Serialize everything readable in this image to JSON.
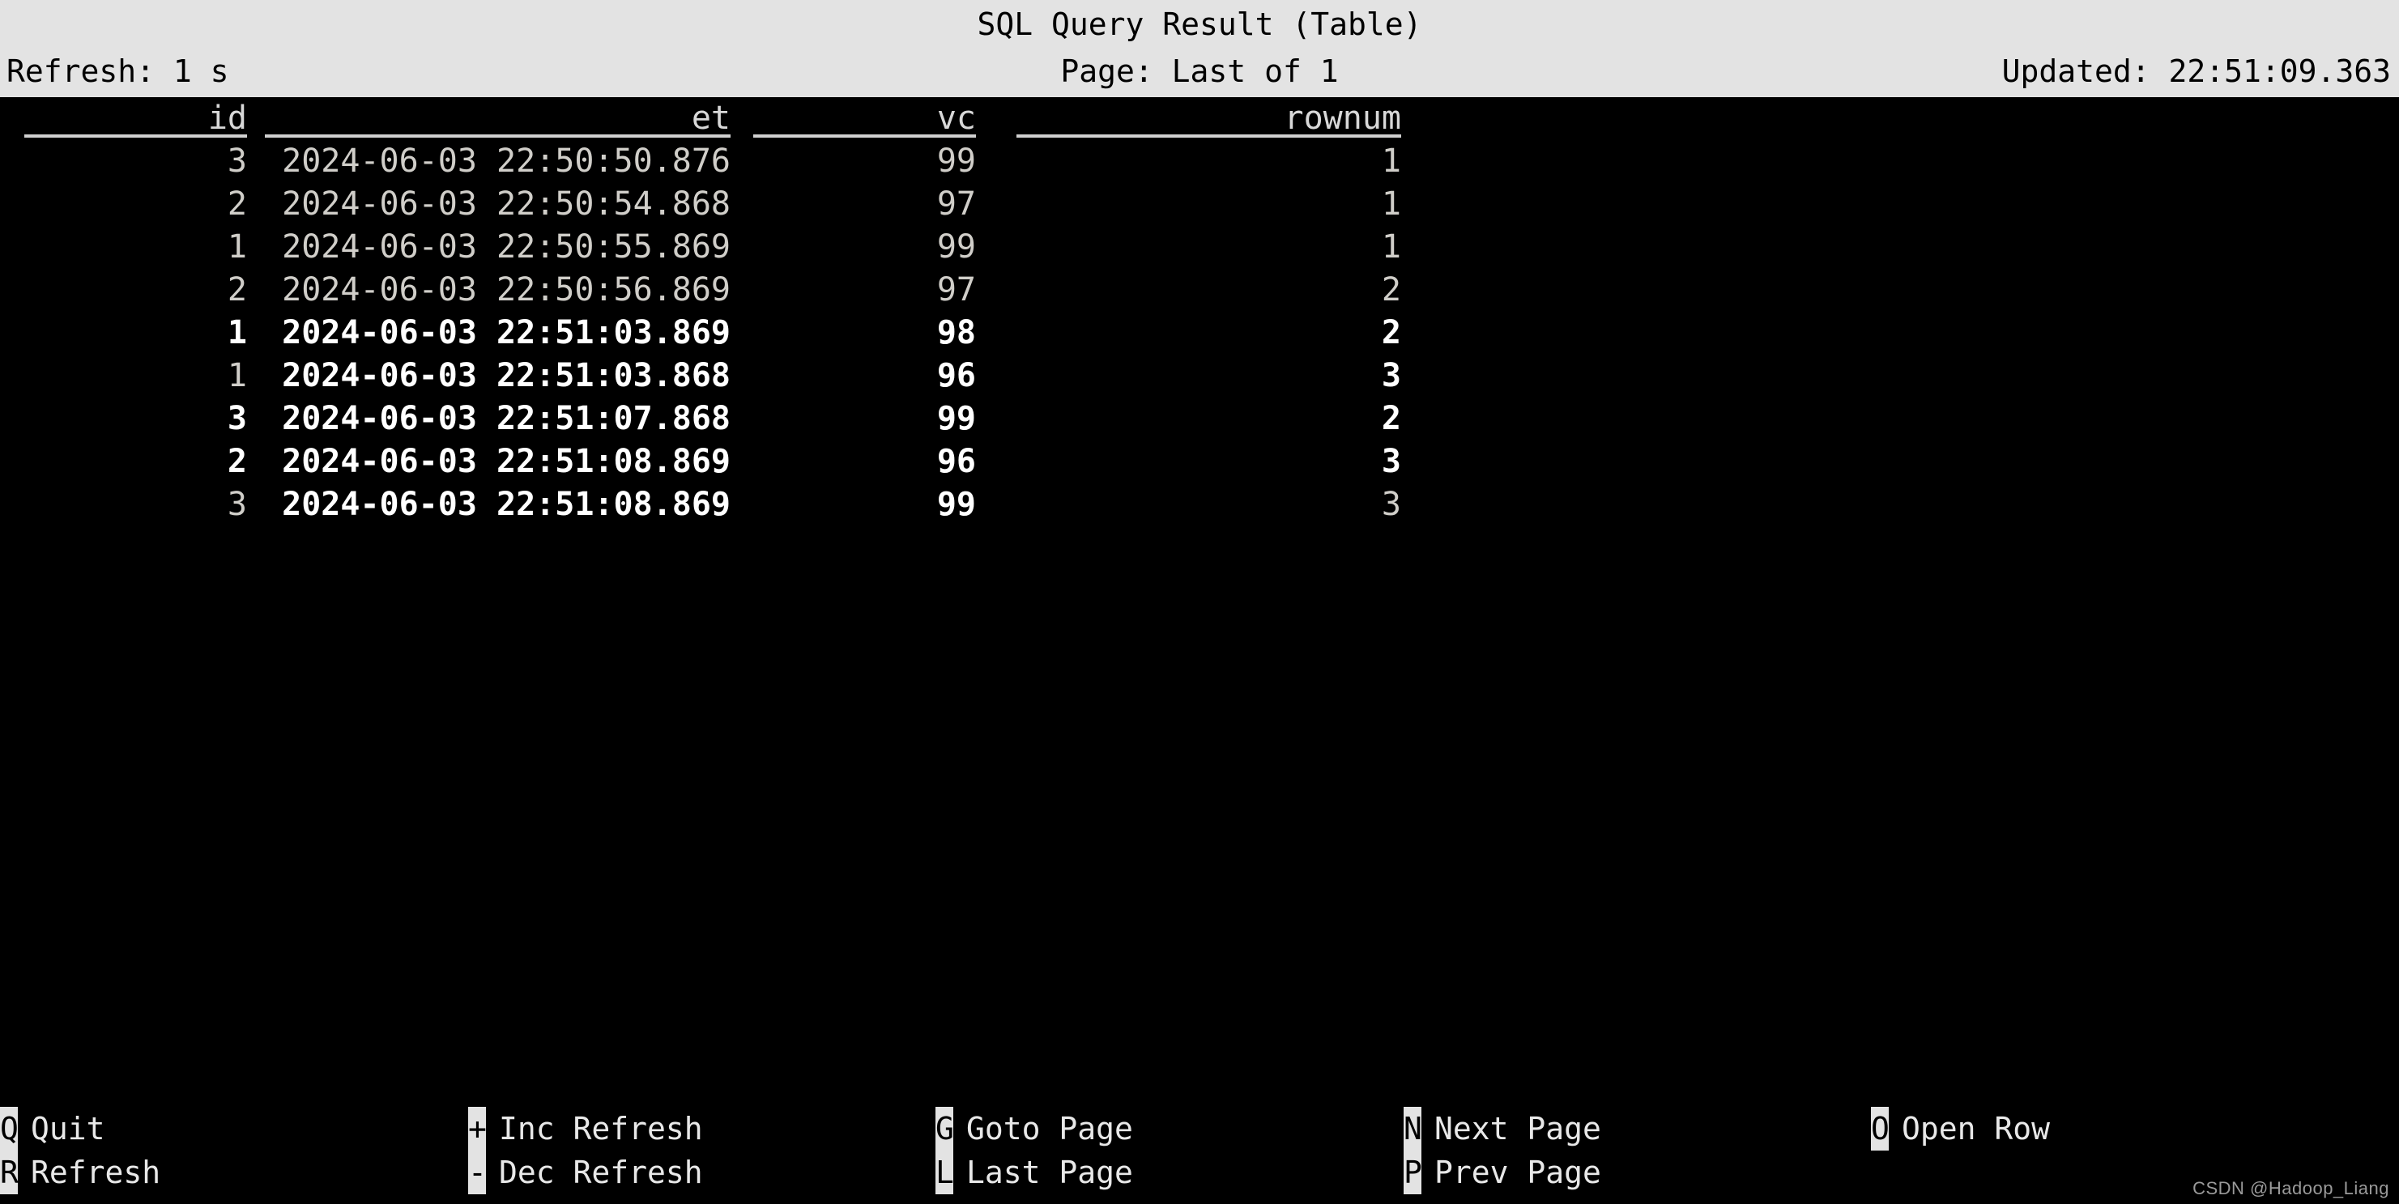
{
  "topbar": {
    "title": "SQL Query Result (Table)",
    "refresh": "Refresh: 1 s",
    "page": "Page: Last of 1",
    "updated": "Updated: 22:51:09.363",
    "background_color": "#e3e3e3",
    "text_color": "#000000"
  },
  "table": {
    "columns": [
      {
        "key": "id",
        "header": "id",
        "align": "right"
      },
      {
        "key": "et",
        "header": "et",
        "align": "right"
      },
      {
        "key": "vc",
        "header": "vc",
        "align": "right"
      },
      {
        "key": "rownum",
        "header": "rownum",
        "align": "right"
      }
    ],
    "rows": [
      {
        "id": "3",
        "et": "2024-06-03 22:50:50.876",
        "vc": "99",
        "rownum": "1",
        "bold": {
          "id": false,
          "et": false,
          "vc": false,
          "rownum": false
        }
      },
      {
        "id": "2",
        "et": "2024-06-03 22:50:54.868",
        "vc": "97",
        "rownum": "1",
        "bold": {
          "id": false,
          "et": false,
          "vc": false,
          "rownum": false
        }
      },
      {
        "id": "1",
        "et": "2024-06-03 22:50:55.869",
        "vc": "99",
        "rownum": "1",
        "bold": {
          "id": false,
          "et": false,
          "vc": false,
          "rownum": false
        }
      },
      {
        "id": "2",
        "et": "2024-06-03 22:50:56.869",
        "vc": "97",
        "rownum": "2",
        "bold": {
          "id": false,
          "et": false,
          "vc": false,
          "rownum": false
        }
      },
      {
        "id": "1",
        "et": "2024-06-03 22:51:03.869",
        "vc": "98",
        "rownum": "2",
        "bold": {
          "id": true,
          "et": true,
          "vc": true,
          "rownum": true
        }
      },
      {
        "id": "1",
        "et": "2024-06-03 22:51:03.868",
        "vc": "96",
        "rownum": "3",
        "bold": {
          "id": false,
          "et": true,
          "vc": true,
          "rownum": true
        }
      },
      {
        "id": "3",
        "et": "2024-06-03 22:51:07.868",
        "vc": "99",
        "rownum": "2",
        "bold": {
          "id": true,
          "et": true,
          "vc": true,
          "rownum": true
        }
      },
      {
        "id": "2",
        "et": "2024-06-03 22:51:08.869",
        "vc": "96",
        "rownum": "3",
        "bold": {
          "id": true,
          "et": true,
          "vc": true,
          "rownum": true
        }
      },
      {
        "id": "3",
        "et": "2024-06-03 22:51:08.869",
        "vc": "99",
        "rownum": "3",
        "bold": {
          "id": false,
          "et": true,
          "vc": true,
          "rownum": false
        }
      }
    ]
  },
  "helpbar": {
    "columns": [
      [
        {
          "key": "Q",
          "label": "Quit"
        },
        {
          "key": "R",
          "label": "Refresh"
        }
      ],
      [
        {
          "key": "+",
          "label": "Inc Refresh"
        },
        {
          "key": "-",
          "label": "Dec Refresh"
        }
      ],
      [
        {
          "key": "G",
          "label": "Goto Page"
        },
        {
          "key": "L",
          "label": "Last Page"
        }
      ],
      [
        {
          "key": "N",
          "label": "Next Page"
        },
        {
          "key": "P",
          "label": "Prev Page"
        }
      ],
      [
        {
          "key": "O",
          "label": "Open Row"
        }
      ]
    ],
    "key_background_color": "#e3e3e3",
    "key_text_color": "#000000"
  },
  "watermark": "CSDN @Hadoop_Liang"
}
